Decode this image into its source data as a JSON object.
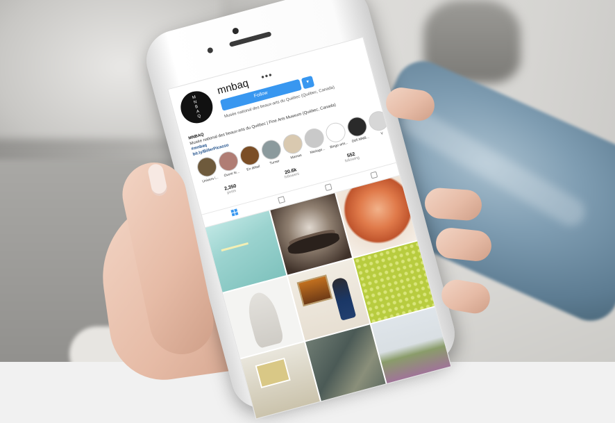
{
  "profile": {
    "username": "mnbaq",
    "more": "•••",
    "follow_label": "Follow",
    "follow_arrow": "▾",
    "tagline": "Musée national des beaux-arts du Québec (Québec, Canada)",
    "avatar_letters": [
      "M",
      "N",
      "B",
      "A",
      "Q"
    ]
  },
  "bio": {
    "name": "MNBAQ",
    "line1": "Musée national des beaux-arts du Québec | Fine Arts Museum (Québec, Canada)",
    "hashtag": "#mnbaq",
    "link": "bit.ly/BillerPicasso"
  },
  "highlights": [
    {
      "label": "Univers i...",
      "color": "#6e5a3c"
    },
    {
      "label": "Ouvrir le...",
      "color": "#b07d74"
    },
    {
      "label": "En détail",
      "color": "#7b4e26"
    },
    {
      "label": "Turner",
      "color": "#8b9a9d"
    },
    {
      "label": "Mamas",
      "color": "#d9c9b0"
    },
    {
      "label": "Mariage...",
      "color": "#c9c9c9"
    },
    {
      "label": "Bingo arts...",
      "color": "#ffffff"
    },
    {
      "label": "Défi MNB...",
      "color": "#2a2a2a"
    },
    {
      "label": "V",
      "color": "#d7d7d7"
    }
  ],
  "stats": [
    {
      "value": "2,350",
      "label": "posts"
    },
    {
      "value": "20.6k",
      "label": "followers"
    },
    {
      "value": "552",
      "label": "following"
    }
  ],
  "tabs": [
    "grid",
    "list",
    "igtv",
    "tagged"
  ],
  "accent_color": "#3897f0"
}
